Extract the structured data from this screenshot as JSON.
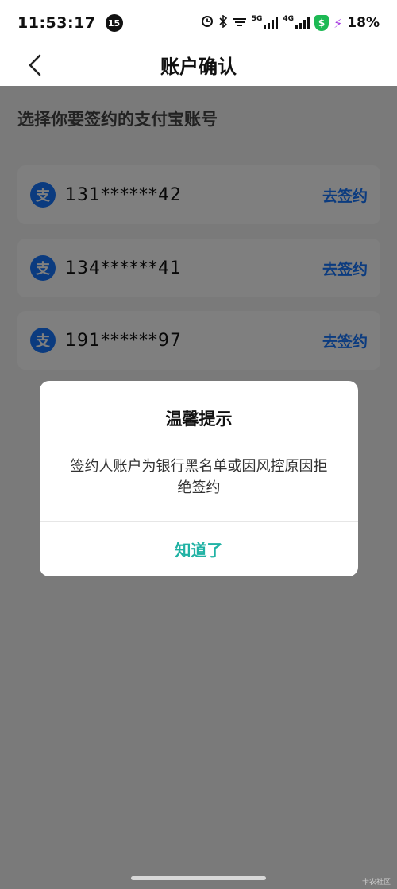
{
  "status_bar": {
    "time": "11:53:17",
    "notification_count": "15",
    "network_1": "5G",
    "network_2": "4G",
    "battery": "18%",
    "shield_symbol": "$"
  },
  "nav": {
    "title": "账户确认",
    "back_icon": "chevron-left-icon"
  },
  "section_title": "选择你要签约的支付宝账号",
  "accounts": [
    {
      "logo_char": "支",
      "number": "131******42",
      "action": "去签约"
    },
    {
      "logo_char": "支",
      "number": "134******41",
      "action": "去签约"
    },
    {
      "logo_char": "支",
      "number": "191******97",
      "action": "去签约"
    }
  ],
  "dialog": {
    "title": "温馨提示",
    "message": "签约人账户为银行黑名单或因风控原因拒绝签约",
    "confirm": "知道了"
  },
  "watermark": "卡农社区",
  "colors": {
    "alipay_blue": "#1677ff",
    "confirm_teal": "#20b2a4",
    "overlay": "rgba(0,0,0,0.5)"
  }
}
